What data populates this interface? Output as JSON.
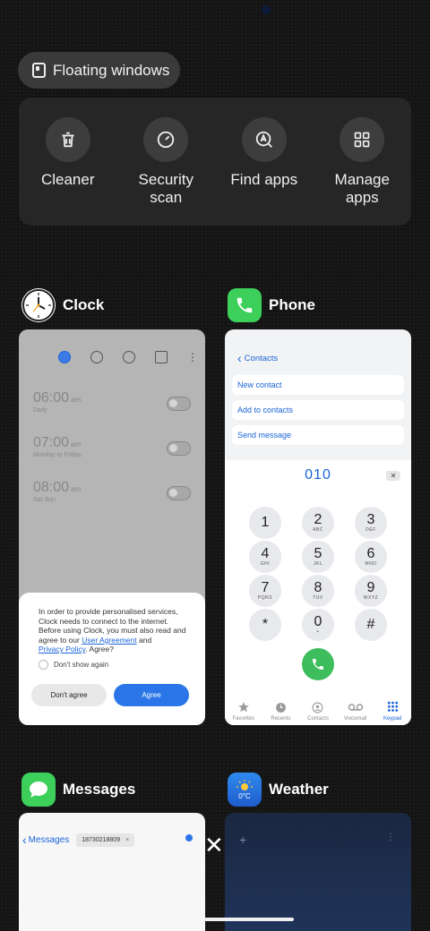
{
  "floating": {
    "label": "Floating windows"
  },
  "actions": [
    {
      "label": "Cleaner",
      "icon": "trash-icon"
    },
    {
      "label": "Security scan",
      "icon": "shield-scan-icon"
    },
    {
      "label": "Find apps",
      "icon": "find-app-icon"
    },
    {
      "label": "Manage apps",
      "icon": "grid-icon"
    }
  ],
  "clock": {
    "title": "Clock",
    "alarms": [
      {
        "time": "06:00",
        "ampm": "am",
        "sub": "Daily"
      },
      {
        "time": "07:00",
        "ampm": "am",
        "sub": "Monday to Friday"
      },
      {
        "time": "08:00",
        "ampm": "am",
        "sub": "Sat Sun"
      }
    ],
    "dialog": {
      "text1": "In order to provide personalised services, Clock needs to connect to the internet. Before using Clock, you must also read and agree to our ",
      "link1": "User Agreement",
      "and": " and ",
      "link2": "Privacy Policy",
      "text2": ". Agree?",
      "dont_show": "Don't show again",
      "disagree": "Don't agree",
      "agree": "Agree"
    }
  },
  "phone": {
    "title": "Phone",
    "back": "Contacts",
    "options": [
      "New contact",
      "Add to contacts",
      "Send message"
    ],
    "number": "010",
    "keys": [
      {
        "d": "1",
        "l": ""
      },
      {
        "d": "2",
        "l": "ABC"
      },
      {
        "d": "3",
        "l": "DEF"
      },
      {
        "d": "4",
        "l": "GHI"
      },
      {
        "d": "5",
        "l": "JKL"
      },
      {
        "d": "6",
        "l": "MNO"
      },
      {
        "d": "7",
        "l": "PQRS"
      },
      {
        "d": "8",
        "l": "TUV"
      },
      {
        "d": "9",
        "l": "WXYZ"
      },
      {
        "d": "*",
        "l": ""
      },
      {
        "d": "0",
        "l": "+"
      },
      {
        "d": "#",
        "l": ""
      }
    ],
    "nav": [
      "Favorites",
      "Recents",
      "Contacts",
      "Voicemail",
      "Keypad"
    ]
  },
  "messages": {
    "title": "Messages",
    "back": "Messages",
    "recipient": "18730218809"
  },
  "weather": {
    "title": "Weather",
    "icon_temp": "0°C"
  }
}
